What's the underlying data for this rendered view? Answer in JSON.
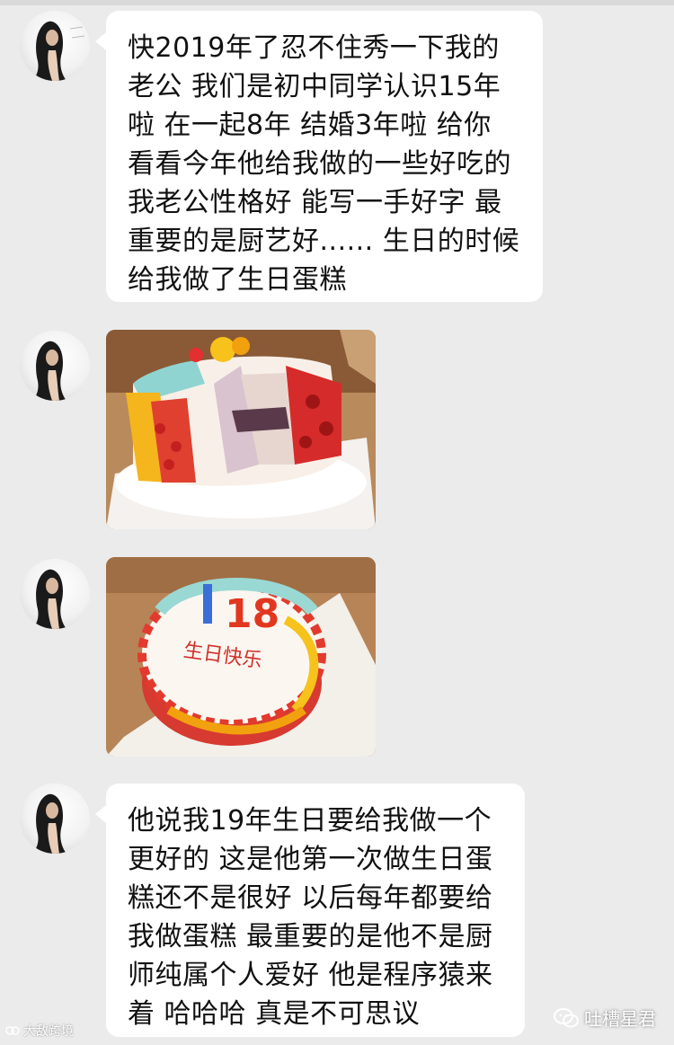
{
  "messages": [
    {
      "type": "text",
      "lines": [
        "快2019年了忍不住秀一下我的",
        "老公 我们是初中同学认识15年",
        "啦 在一起8年 结婚3年啦 给你",
        "看看今年他给我做的一些好吃的",
        "我老公性格好 能写一手好字 最",
        "重要的是厨艺好...... 生日的时候",
        "给我做了生日蛋糕"
      ]
    },
    {
      "type": "image",
      "icon": "cut-cake-photo"
    },
    {
      "type": "image",
      "icon": "birthday-cake-photo",
      "cake_text": "生日快乐",
      "cake_number": "18"
    },
    {
      "type": "text",
      "lines": [
        "他说我19年生日要给我做一个",
        "更好的 这是他第一次做生日蛋",
        "糕还不是很好 以后每年都要给",
        "我做蛋糕 最重要的是他不是厨",
        "师纯属个人爱好 他是程序猿来",
        "着 哈哈哈 真是不可思议"
      ]
    }
  ],
  "watermarks": {
    "left": "大敌跨境",
    "right": "吐槽星君"
  },
  "colors": {
    "background": "#ebebeb",
    "bubble": "#ffffff",
    "text": "#111111"
  }
}
